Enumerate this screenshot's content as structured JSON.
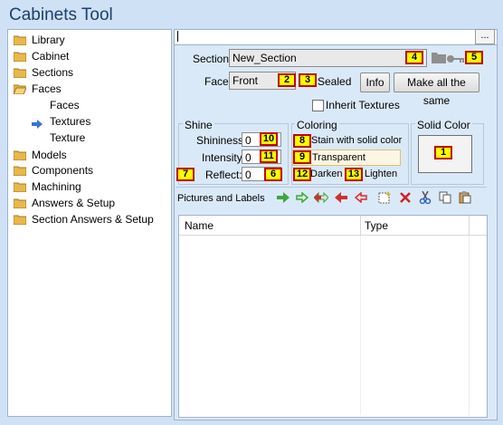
{
  "window": {
    "title": "Cabinets Tool"
  },
  "tree": {
    "items": [
      {
        "label": "Library",
        "icon": "folder-closed-icon"
      },
      {
        "label": "Cabinet",
        "icon": "folder-closed-icon"
      },
      {
        "label": "Sections",
        "icon": "folder-closed-icon"
      },
      {
        "label": "Faces",
        "icon": "folder-open-icon"
      },
      {
        "label": "Faces"
      },
      {
        "label": "Textures",
        "selected": true
      },
      {
        "label": "Texture"
      },
      {
        "label": "Models",
        "icon": "folder-closed-icon"
      },
      {
        "label": "Components",
        "icon": "folder-closed-icon"
      },
      {
        "label": "Machining",
        "icon": "folder-closed-icon"
      },
      {
        "label": "Answers & Setup",
        "icon": "folder-closed-icon"
      },
      {
        "label": "Section Answers & Setup",
        "icon": "folder-closed-icon"
      }
    ]
  },
  "path_bar": {
    "value": "",
    "browse_label": "..."
  },
  "section": {
    "label": "Section:",
    "value": "New_Section"
  },
  "face": {
    "label": "Face:",
    "value": "Front",
    "sealed_label": "Sealed",
    "info_label": "Info",
    "make_same_label": "Make all the same"
  },
  "inherit_textures": {
    "label": "Inherit Textures",
    "checked": false
  },
  "shine": {
    "title": "Shine",
    "shininess_label": "Shininess:",
    "shininess_value": "0",
    "intensity_label": "Intensity:",
    "intensity_value": "0",
    "reflect_label": "Reflect:",
    "reflect_value": "0"
  },
  "coloring": {
    "title": "Coloring",
    "stain_label": "Stain with solid color",
    "transparent_label": "Transparent",
    "darken_label": "Darken",
    "lighten_label": "Lighten"
  },
  "solid_color": {
    "title": "Solid Color",
    "color": "#f3f3f3"
  },
  "pictures": {
    "title": "Pictures and Labels",
    "toolbar_icons": [
      "arrow-right-green-icon",
      "arrow-right-outline-green-icon",
      "arrow-both-icon",
      "arrow-left-red-icon",
      "arrow-left-outline-red-icon",
      "new-item-icon",
      "delete-icon",
      "cut-icon",
      "copy-icon",
      "paste-icon"
    ],
    "columns": [
      "Name",
      "Type"
    ]
  },
  "badges": [
    "1",
    "2",
    "3",
    "4",
    "5",
    "6",
    "7",
    "8",
    "9",
    "10",
    "11",
    "12",
    "13"
  ],
  "colors": {
    "accent": "#1d3f6e",
    "badge_fill": "#ffff00",
    "badge_border": "#c00000",
    "panel_bg": "#dae9f8"
  }
}
